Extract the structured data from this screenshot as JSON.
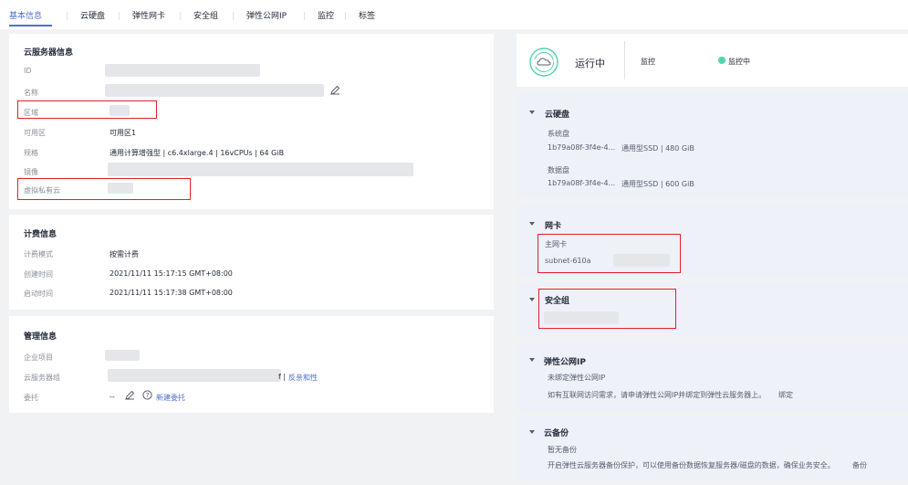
{
  "tabs": [
    {
      "label": "基本信息",
      "active": true
    },
    {
      "label": "云硬盘"
    },
    {
      "label": "弹性网卡"
    },
    {
      "label": "安全组"
    },
    {
      "label": "弹性公网IP"
    },
    {
      "label": "监控"
    },
    {
      "label": "标签"
    }
  ],
  "server_info": {
    "title": "云服务器信息",
    "rows": [
      {
        "label": "ID",
        "value": ""
      },
      {
        "label": "名称",
        "value": ""
      },
      {
        "label": "区域",
        "value": ""
      },
      {
        "label": "可用区",
        "value": "可用区1"
      },
      {
        "label": "规格",
        "value": "通用计算增强型 | c6.4xlarge.4 | 16vCPUs | 64 GiB"
      },
      {
        "label": "镜像",
        "value": ""
      },
      {
        "label": "虚拟私有云",
        "value": ""
      }
    ]
  },
  "billing_info": {
    "title": "计费信息",
    "rows": [
      {
        "label": "计费模式",
        "value": "按需计费"
      },
      {
        "label": "创建时间",
        "value": "2021/11/11 15:17:15 GMT+08:00"
      },
      {
        "label": "启动时间",
        "value": "2021/11/11 15:17:38 GMT+08:00"
      }
    ]
  },
  "mgmt_info": {
    "title": "管理信息",
    "rows": [
      {
        "label": "企业项目",
        "value": ""
      },
      {
        "label": "云服务器组",
        "value_suffix": "f |",
        "link": "反亲和性"
      },
      {
        "label": "委托",
        "value": "--",
        "link": "新建委托"
      }
    ]
  },
  "status": {
    "state": "运行中",
    "monitor_label": "监控",
    "monitor_status": "监控中"
  },
  "disk": {
    "title": "云硬盘",
    "system_label": "系统盘",
    "system_id": "1b79a08f-3f4e-4...",
    "system_spec": "通用型SSD | 480 GiB",
    "data_label": "数据盘",
    "data_id": "1b79a08f-3f4e-4...",
    "data_spec": "通用型SSD | 600 GiB"
  },
  "nic": {
    "title": "网卡",
    "primary_label": "主网卡",
    "subnet": "subnet-610a"
  },
  "security_group": {
    "title": "安全组"
  },
  "eip": {
    "title": "弹性公网IP",
    "unbound": "未绑定弹性公网IP",
    "hint": "如有互联网访问需求，请申请弹性公网IP并绑定到弹性云服务器上。",
    "bind_link": "绑定"
  },
  "backup": {
    "title": "云备份",
    "none": "暂无备份",
    "hint": "开启弹性云服务器备份保护，可以使用备份数据恢复服务器/磁盘的数据，确保业务安全。",
    "backup_link": "备份"
  },
  "colors": {
    "accent": "#526ecc",
    "highlight": "#e41f2b",
    "running": "#50d4ab"
  }
}
